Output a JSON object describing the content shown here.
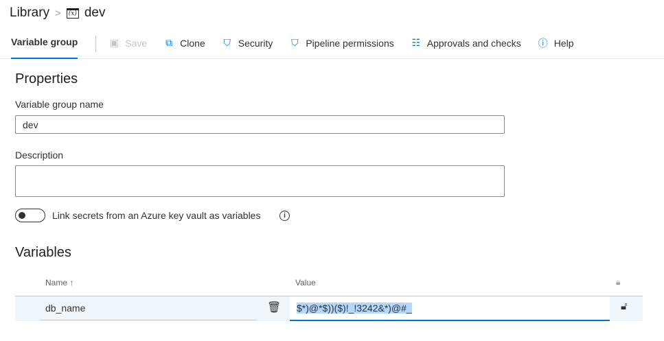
{
  "breadcrumb": {
    "root": "Library",
    "current": "dev"
  },
  "toolbar": {
    "tab": "Variable group",
    "save": "Save",
    "clone": "Clone",
    "security": "Security",
    "pipeline_permissions": "Pipeline permissions",
    "approvals": "Approvals and checks",
    "help": "Help"
  },
  "properties": {
    "heading": "Properties",
    "name_label": "Variable group name",
    "name_value": "dev",
    "description_label": "Description",
    "description_value": "",
    "link_secrets_label": "Link secrets from an Azure key vault as variables",
    "link_secrets_on": false
  },
  "variables": {
    "heading": "Variables",
    "col_name": "Name ↑",
    "col_value": "Value",
    "rows": [
      {
        "name": "db_name",
        "value": "$*)@*$))($)!_!3242&*)@#_"
      }
    ]
  },
  "colors": {
    "accent": "#0078d4",
    "row_bg": "#eff6fc",
    "selection": "#b3d7ff"
  }
}
